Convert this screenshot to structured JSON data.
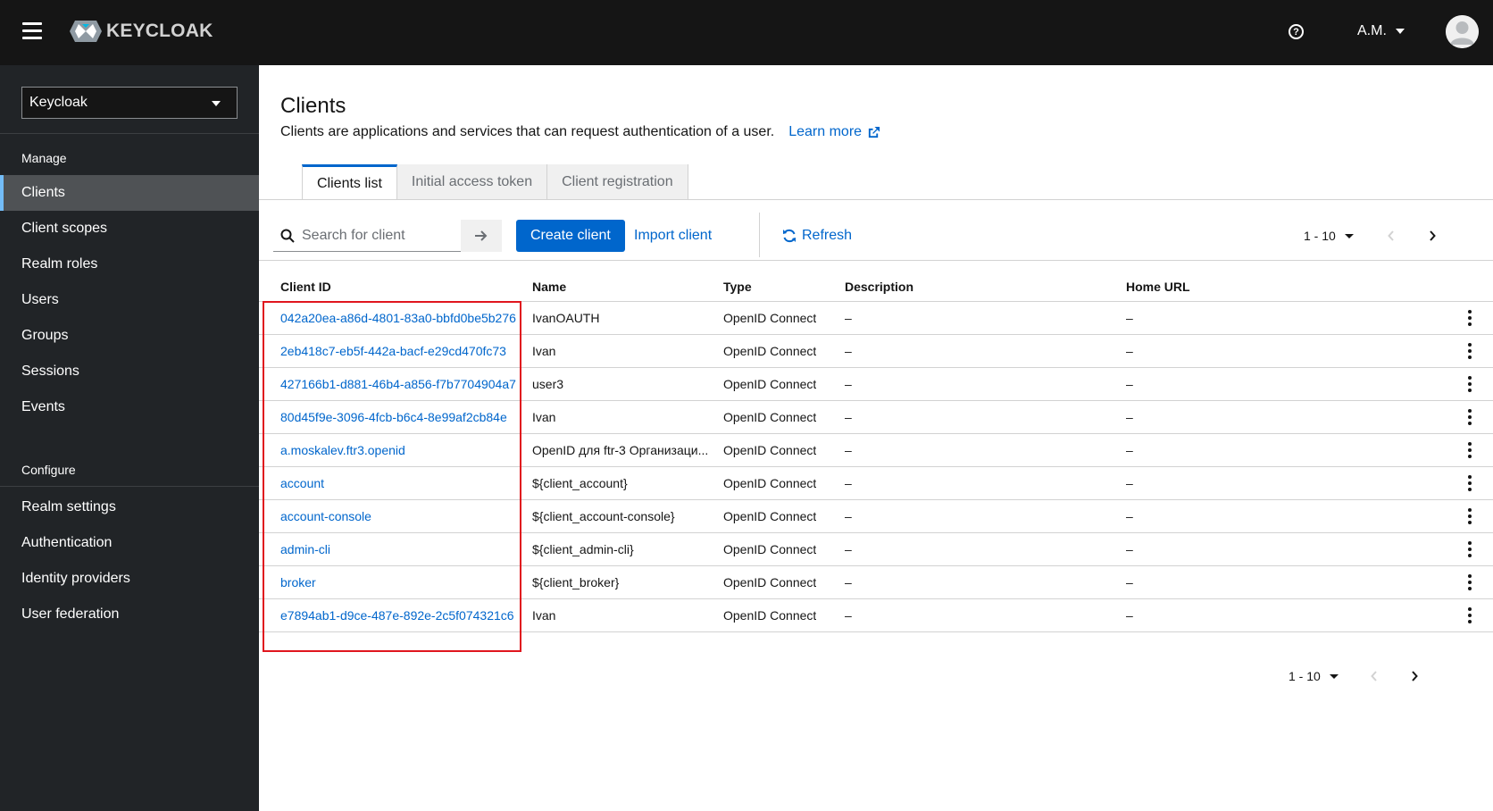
{
  "masthead": {
    "brand_text": "KEYCLOAK",
    "help_icon": "question-circle-icon",
    "user_name": "A.M."
  },
  "sidebar": {
    "realm": "Keycloak",
    "sections": [
      {
        "title": "Manage",
        "items": [
          "Clients",
          "Client scopes",
          "Realm roles",
          "Users",
          "Groups",
          "Sessions",
          "Events"
        ]
      },
      {
        "title": "Configure",
        "items": [
          "Realm settings",
          "Authentication",
          "Identity providers",
          "User federation"
        ]
      }
    ],
    "active_item": "Clients"
  },
  "page": {
    "title": "Clients",
    "description": "Clients are applications and services that can request authentication of a user.",
    "learn_more": "Learn more"
  },
  "tabs": [
    "Clients list",
    "Initial access token",
    "Client registration"
  ],
  "toolbar": {
    "search_placeholder": "Search for client",
    "create_client": "Create client",
    "import_client": "Import client",
    "refresh": "Refresh",
    "pagination": "1 - 10"
  },
  "table": {
    "columns": [
      "Client ID",
      "Name",
      "Type",
      "Description",
      "Home URL"
    ],
    "rows": [
      {
        "client_id": "042a20ea-a86d-4801-83a0-bbfd0be5b276",
        "name": "IvanOAUTH",
        "type": "OpenID Connect",
        "description": "–",
        "home_url": "–"
      },
      {
        "client_id": "2eb418c7-eb5f-442a-bacf-e29cd470fc73",
        "name": "Ivan",
        "type": "OpenID Connect",
        "description": "–",
        "home_url": "–"
      },
      {
        "client_id": "427166b1-d881-46b4-a856-f7b7704904a7",
        "name": "user3",
        "type": "OpenID Connect",
        "description": "–",
        "home_url": "–"
      },
      {
        "client_id": "80d45f9e-3096-4fcb-b6c4-8e99af2cb84e",
        "name": "Ivan",
        "type": "OpenID Connect",
        "description": "–",
        "home_url": "–"
      },
      {
        "client_id": "a.moskalev.ftr3.openid",
        "name": "OpenID для ftr-3 Организаци...",
        "type": "OpenID Connect",
        "description": "–",
        "home_url": "–"
      },
      {
        "client_id": "account",
        "name": "${client_account}",
        "type": "OpenID Connect",
        "description": "–",
        "home_url": "–"
      },
      {
        "client_id": "account-console",
        "name": "${client_account-console}",
        "type": "OpenID Connect",
        "description": "–",
        "home_url": "–"
      },
      {
        "client_id": "admin-cli",
        "name": "${client_admin-cli}",
        "type": "OpenID Connect",
        "description": "–",
        "home_url": "–"
      },
      {
        "client_id": "broker",
        "name": "${client_broker}",
        "type": "OpenID Connect",
        "description": "–",
        "home_url": "–"
      },
      {
        "client_id": "e7894ab1-d9ce-487e-892e-2c5f074321c6",
        "name": "Ivan",
        "type": "OpenID Connect",
        "description": "–",
        "home_url": "–"
      }
    ]
  },
  "footer_pagination": "1 - 10",
  "colors": {
    "masthead_bg": "#151515",
    "sidebar_bg": "#212427",
    "primary": "#0066cc",
    "highlight": "#e0161e"
  }
}
